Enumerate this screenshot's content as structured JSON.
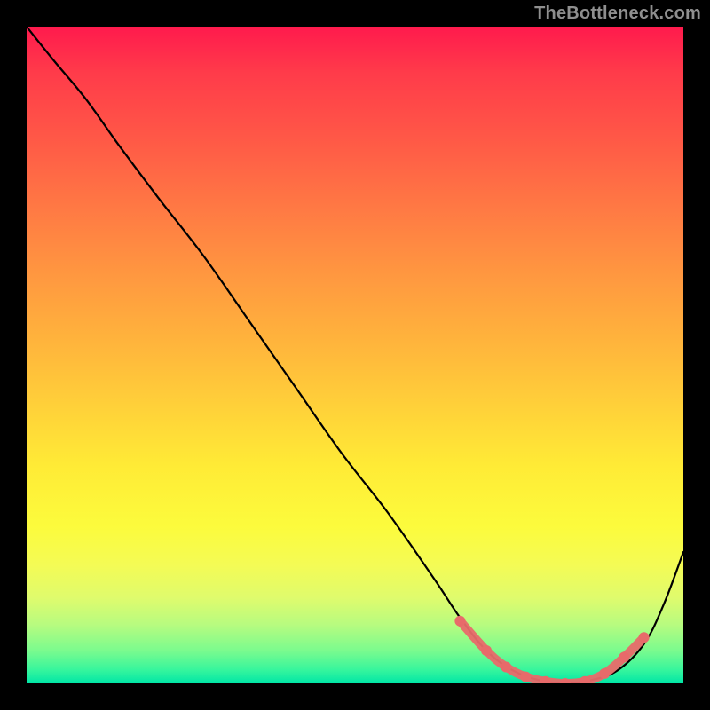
{
  "meta": {
    "watermark": "TheBottleneck.com"
  },
  "colors": {
    "curve": "#000000",
    "highlight": "#e86a6a",
    "background_black": "#000000"
  },
  "chart_data": {
    "type": "line",
    "title": "",
    "xlabel": "",
    "ylabel": "",
    "xlim": [
      0,
      1
    ],
    "ylim": [
      0,
      1
    ],
    "grid": false,
    "legend": false,
    "series": [
      {
        "name": "bottleneck-curve",
        "x": [
          0.0,
          0.04,
          0.09,
          0.14,
          0.2,
          0.27,
          0.34,
          0.41,
          0.48,
          0.55,
          0.62,
          0.66,
          0.7,
          0.74,
          0.78,
          0.82,
          0.86,
          0.9,
          0.94,
          0.97,
          1.0
        ],
        "y": [
          1.0,
          0.95,
          0.89,
          0.82,
          0.74,
          0.65,
          0.55,
          0.45,
          0.35,
          0.26,
          0.16,
          0.1,
          0.05,
          0.02,
          0.005,
          0.0,
          0.005,
          0.02,
          0.06,
          0.12,
          0.2
        ]
      }
    ],
    "highlight": {
      "name": "valley-highlight",
      "x": [
        0.66,
        0.7,
        0.73,
        0.76,
        0.79,
        0.82,
        0.85,
        0.88,
        0.91,
        0.94
      ],
      "y": [
        0.095,
        0.05,
        0.025,
        0.01,
        0.003,
        0.0,
        0.003,
        0.015,
        0.04,
        0.07
      ]
    }
  }
}
